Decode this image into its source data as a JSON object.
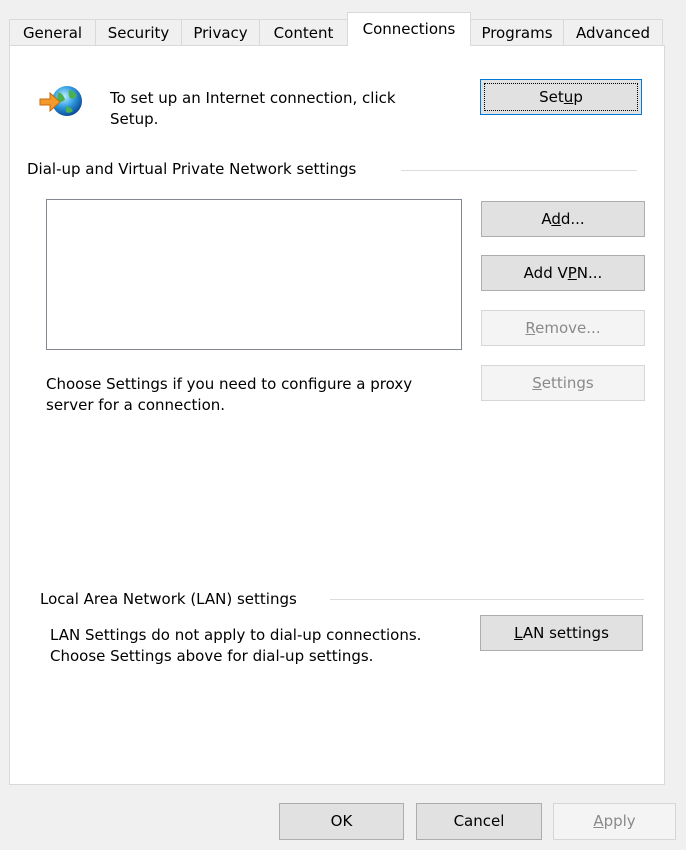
{
  "tabs": [
    {
      "label": "General",
      "active": false
    },
    {
      "label": "Security",
      "active": false
    },
    {
      "label": "Privacy",
      "active": false
    },
    {
      "label": "Content",
      "active": false
    },
    {
      "label": "Connections",
      "active": true
    },
    {
      "label": "Programs",
      "active": false
    },
    {
      "label": "Advanced",
      "active": false
    }
  ],
  "setup": {
    "text_line1": "To set up an Internet connection, click",
    "text_line2": "Setup.",
    "button_pre": "Set",
    "button_u": "u",
    "button_post": "p",
    "icon": "globe-arrow-icon"
  },
  "dialup": {
    "group_label": "Dial-up and Virtual Private Network settings",
    "add_pre": "A",
    "add_u": "d",
    "add_post": "d...",
    "addvpn_pre": "Add V",
    "addvpn_u": "P",
    "addvpn_post": "N...",
    "remove_pre": "",
    "remove_u": "R",
    "remove_post": "emove...",
    "proxy_line1": "Choose Settings if you need to configure a proxy",
    "proxy_line2": "server for a connection.",
    "settings_pre": "",
    "settings_u": "S",
    "settings_post": "ettings"
  },
  "lan": {
    "group_label": "Local Area Network (LAN) settings",
    "line1": "LAN Settings do not apply to dial-up connections.",
    "line2": "Choose Settings above for dial-up settings.",
    "button_pre": "",
    "button_u": "L",
    "button_post": "AN settings"
  },
  "footer": {
    "ok_label": "OK",
    "cancel_label": "Cancel",
    "apply_pre": "",
    "apply_u": "A",
    "apply_post": "pply"
  },
  "colors": {
    "window_bg": "#f0f0f0",
    "panel_bg": "#ffffff",
    "button_bg": "#e1e1e1",
    "default_border": "#0078d7",
    "disabled_text": "#8a8a8a"
  }
}
